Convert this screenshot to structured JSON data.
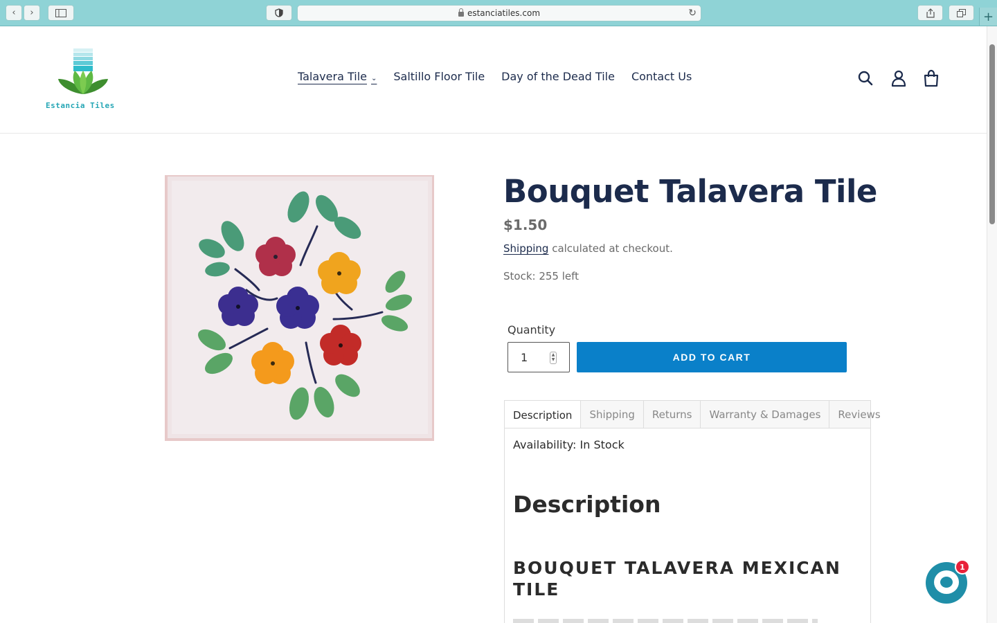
{
  "browser": {
    "url": "estanciatiles.com",
    "icons": [
      "back-icon",
      "forward-icon",
      "sidebar-icon",
      "shield-icon",
      "lock-icon",
      "reload-icon",
      "share-icon",
      "tabs-icon",
      "new-tab-icon"
    ]
  },
  "header": {
    "logo_text": "Estancia Tiles",
    "nav": [
      {
        "label": "Talavera Tile",
        "has_dropdown": true,
        "active": true
      },
      {
        "label": "Saltillo Floor Tile"
      },
      {
        "label": "Day of the Dead Tile"
      },
      {
        "label": "Contact Us"
      }
    ],
    "icons": [
      "search-icon",
      "account-icon",
      "cart-icon"
    ]
  },
  "product": {
    "title": "Bouquet Talavera Tile",
    "price": "$1.50",
    "shipping_link": "Shipping",
    "shipping_text": " calculated at checkout.",
    "stock": "Stock: 255 left",
    "quantity_label": "Quantity",
    "quantity_value": "1",
    "add_to_cart": "ADD TO CART"
  },
  "tabs": [
    {
      "label": "Description",
      "active": true
    },
    {
      "label": "Shipping"
    },
    {
      "label": "Returns"
    },
    {
      "label": "Warranty & Damages"
    },
    {
      "label": "Reviews"
    }
  ],
  "panel": {
    "availability": "Availability: In Stock",
    "heading": "Description",
    "subheading": "BOUQUET TALAVERA MEXICAN TILE"
  },
  "chat": {
    "badge_count": "1"
  },
  "colors": {
    "chrome": "#8fd3d6",
    "nav_text": "#1c2b4c",
    "button": "#0a80c9",
    "logo_teal": "#25a6b5",
    "chat": "#1f8ea8",
    "badge": "#e8223a"
  }
}
